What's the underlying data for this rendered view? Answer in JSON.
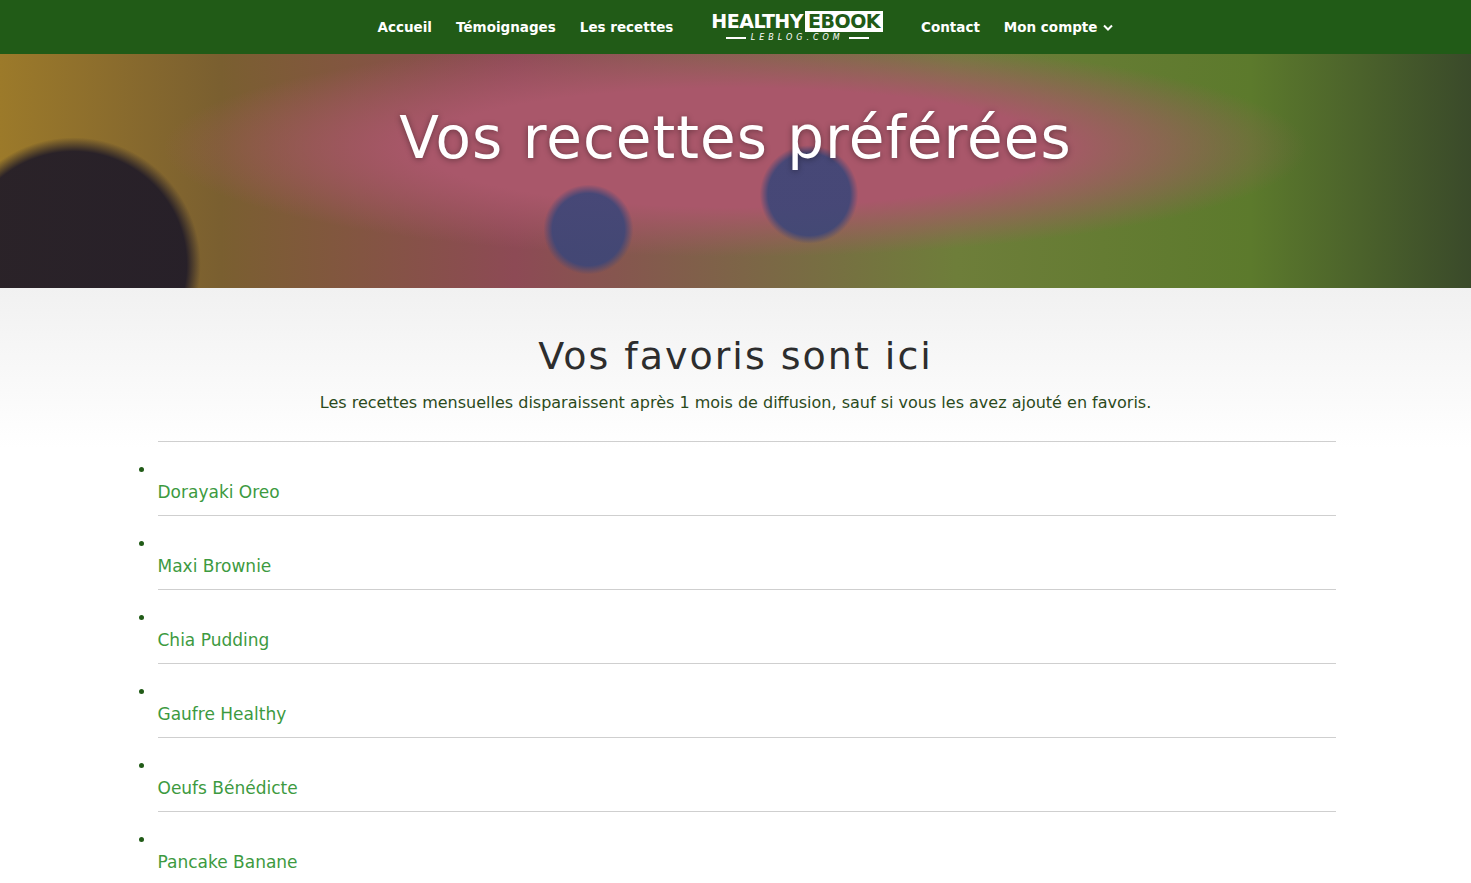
{
  "nav": {
    "left": [
      "Accueil",
      "Témoignages",
      "Les recettes"
    ],
    "logo": {
      "main": "HEALTHY",
      "boxed": "EBOOK",
      "sub": "LEBLOG.COM"
    },
    "right": [
      {
        "label": "Contact",
        "dropdown": false
      },
      {
        "label": "Mon compte",
        "dropdown": true
      }
    ]
  },
  "hero": {
    "title": "Vos recettes préférées"
  },
  "section": {
    "heading": "Vos favoris sont ici",
    "subtitle": "Les recettes mensuelles disparaissent après 1 mois de diffusion, sauf si vous les avez ajouté en favoris."
  },
  "favorites": [
    "Dorayaki Oreo",
    "Maxi Brownie",
    "Chia Pudding",
    "Gaufre Healthy",
    "Oeufs Bénédicte",
    "Pancake Banane"
  ]
}
